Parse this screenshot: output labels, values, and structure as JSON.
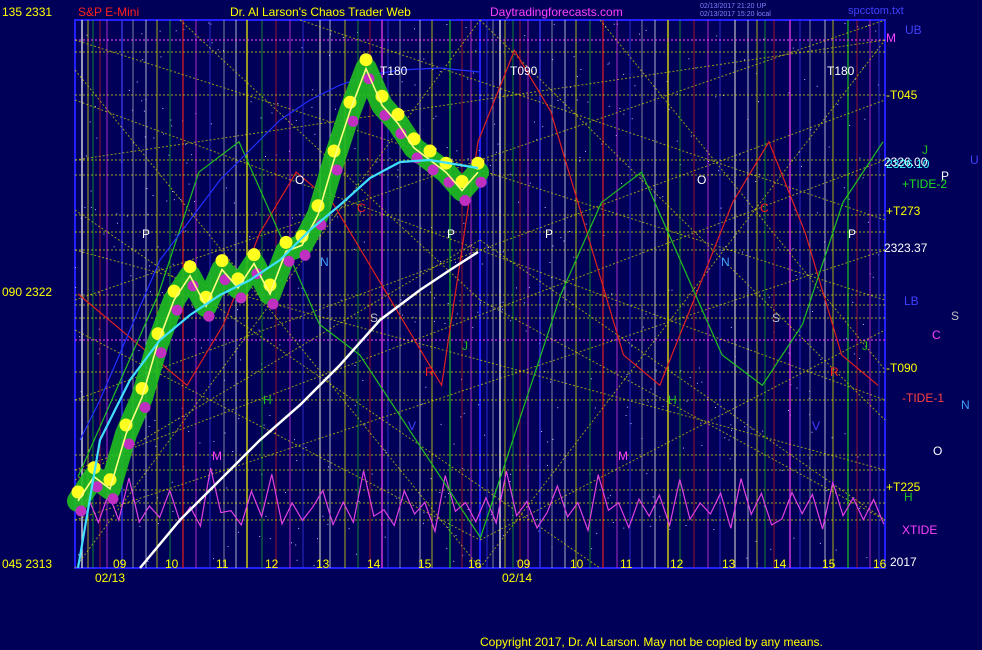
{
  "header": {
    "left_price_top": "135  2331",
    "symbol": "S&P E-Mini",
    "title": "Dr. Al Larson's Chaos Trader Web",
    "site": "Daytradingforecasts.com",
    "stamp1": "02/13/2017 21:20 UP",
    "stamp2": "02/13/2017 15:20 local",
    "file": "spcctom.txt"
  },
  "left_axis": {
    "mid": "090  2322",
    "bottom": "045  2313"
  },
  "right_labels": {
    "ub": "UB",
    "m": "M",
    "t045": "-T045",
    "j": "J",
    "u": "U",
    "price1": "2326.00",
    "price2": "2326.10",
    "p": "P",
    "tide2": "+TIDE-2",
    "t273": "+T273",
    "price3": "2323.37",
    "lb": "LB",
    "s": "S",
    "c": "C",
    "t090": "-T090",
    "tide1": "-TIDE-1",
    "n": "N",
    "o": "O",
    "t225": "+T225",
    "h": "H",
    "xtide": "XTIDE",
    "year": "2017"
  },
  "x_axis": {
    "day1": "02/13",
    "day2": "02/14",
    "hours1": [
      "09",
      "10",
      "11",
      "12",
      "13",
      "14",
      "15",
      "16"
    ],
    "hours2": [
      "09",
      "10",
      "11",
      "12",
      "13",
      "14",
      "15",
      "16"
    ]
  },
  "markers": {
    "t180_a": "T180",
    "t090_a": "T090",
    "t180_b": "T180",
    "letters": [
      "P",
      "O",
      "N",
      "C",
      "S",
      "R",
      "V",
      "H",
      "M",
      "J",
      "P",
      "P",
      "O",
      "N",
      "C",
      "S",
      "R",
      "V",
      "H",
      "M",
      "J",
      "P"
    ]
  },
  "colors": {
    "background": "#000058",
    "frame": "#2020ff",
    "yellow_grid": "#d8d800",
    "green_band": "#20c020",
    "magenta": "#e040e0",
    "cyan": "#40e0ff",
    "white": "#ffffff",
    "red": "#e02020",
    "green": "#20c020"
  },
  "chart_data": {
    "type": "line",
    "title": "S&P E-Mini",
    "ylim": [
      2313,
      2331
    ],
    "y_ticks": [
      2313,
      2322,
      2331
    ],
    "x_categories_day1": [
      "09",
      "10",
      "11",
      "12",
      "13",
      "14",
      "15",
      "16"
    ],
    "x_categories_day2": [
      "09",
      "10",
      "11",
      "12",
      "13",
      "14",
      "15",
      "16"
    ],
    "price_levels_right": [
      2326.0,
      2326.1,
      2323.37
    ],
    "series": [
      {
        "name": "S&P E-Mini",
        "values": [
          2315.2,
          2316.0,
          2315.6,
          2317.4,
          2318.6,
          2320.4,
          2321.8,
          2322.6,
          2321.6,
          2322.8,
          2322.2,
          2323.0,
          2322.0,
          2323.4,
          2323.6,
          2324.6,
          2326.4,
          2328.0,
          2329.4,
          2328.2,
          2327.6,
          2326.8,
          2326.4,
          2326.0,
          2325.4,
          2326.0
        ]
      },
      {
        "name": "+TIDE-2",
        "values": [
          2316,
          2319,
          2322,
          2326,
          2327,
          2324,
          2321,
          2320,
          2318,
          2316,
          2314,
          2318,
          2322,
          2325,
          2326,
          2323,
          2320,
          2319,
          2321,
          2325,
          2327
        ]
      },
      {
        "name": "-TIDE-1",
        "values": [
          2322,
          2321,
          2320,
          2319,
          2321,
          2324,
          2326,
          2325,
          2323,
          2321,
          2319,
          2327,
          2330,
          2328,
          2324,
          2320,
          2319,
          2322,
          2325,
          2327,
          2324,
          2320,
          2319
        ]
      },
      {
        "name": "XTIDE",
        "values": [
          2314.8,
          2315.5,
          2314.6,
          2315.3,
          2314.4,
          2316.0,
          2314.7,
          2315.1,
          2314.5,
          2315.4,
          2314.6,
          2315.2,
          2314.4,
          2316.1,
          2314.7,
          2315.0,
          2314.6,
          2315.5,
          2314.5,
          2316.0,
          2314.6,
          2315.3,
          2314.5
        ]
      }
    ]
  },
  "footer": {
    "copyright": "Copyright 2017, Dr. Al Larson. May not be copied by any means."
  }
}
